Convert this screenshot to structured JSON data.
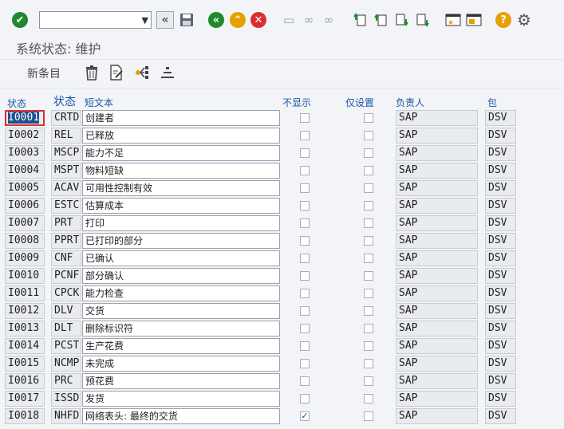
{
  "toolbar": {
    "command_field": {
      "value": "",
      "dropdown_icon": "chevron-down-icon"
    },
    "buttons": [
      {
        "name": "enter",
        "icon": "checkmark-icon",
        "color": "#1f8a2b"
      },
      {
        "name": "back-nav",
        "icon": "double-chevron-left-icon"
      },
      {
        "name": "save",
        "icon": "floppy-disk-icon"
      },
      {
        "name": "back",
        "icon": "back-icon",
        "color": "#1f8a2b"
      },
      {
        "name": "exit",
        "icon": "up-icon",
        "color": "#e5a100"
      },
      {
        "name": "cancel",
        "icon": "cancel-icon",
        "color": "#d9302f"
      }
    ]
  },
  "screen_title": "系统状态: 维护",
  "app_toolbar": {
    "new_entries_label": "新条目"
  },
  "columns": {
    "status1": "状态",
    "status2": "状态",
    "short_text": "短文本",
    "no_display": "不显示",
    "set_only": "仅设置",
    "responsible": "负责人",
    "package": "包"
  },
  "rows": [
    {
      "id": "I0001",
      "code": "CRTD",
      "text": "创建者",
      "no_display": false,
      "set_only": false,
      "responsible": "SAP",
      "package": "DSV"
    },
    {
      "id": "I0002",
      "code": "REL",
      "text": "已释放",
      "no_display": false,
      "set_only": false,
      "responsible": "SAP",
      "package": "DSV"
    },
    {
      "id": "I0003",
      "code": "MSCP",
      "text": "能力不足",
      "no_display": false,
      "set_only": false,
      "responsible": "SAP",
      "package": "DSV"
    },
    {
      "id": "I0004",
      "code": "MSPT",
      "text": "物料短缺",
      "no_display": false,
      "set_only": false,
      "responsible": "SAP",
      "package": "DSV"
    },
    {
      "id": "I0005",
      "code": "ACAV",
      "text": "可用性控制有效",
      "no_display": false,
      "set_only": false,
      "responsible": "SAP",
      "package": "DSV"
    },
    {
      "id": "I0006",
      "code": "ESTC",
      "text": "估算成本",
      "no_display": false,
      "set_only": false,
      "responsible": "SAP",
      "package": "DSV"
    },
    {
      "id": "I0007",
      "code": "PRT",
      "text": "打印",
      "no_display": false,
      "set_only": false,
      "responsible": "SAP",
      "package": "DSV"
    },
    {
      "id": "I0008",
      "code": "PPRT",
      "text": "已打印的部分",
      "no_display": false,
      "set_only": false,
      "responsible": "SAP",
      "package": "DSV"
    },
    {
      "id": "I0009",
      "code": "CNF",
      "text": "已确认",
      "no_display": false,
      "set_only": false,
      "responsible": "SAP",
      "package": "DSV"
    },
    {
      "id": "I0010",
      "code": "PCNF",
      "text": "部分确认",
      "no_display": false,
      "set_only": false,
      "responsible": "SAP",
      "package": "DSV"
    },
    {
      "id": "I0011",
      "code": "CPCK",
      "text": "能力检查",
      "no_display": false,
      "set_only": false,
      "responsible": "SAP",
      "package": "DSV"
    },
    {
      "id": "I0012",
      "code": "DLV",
      "text": "交货",
      "no_display": false,
      "set_only": false,
      "responsible": "SAP",
      "package": "DSV"
    },
    {
      "id": "I0013",
      "code": "DLT",
      "text": "删除标识符",
      "no_display": false,
      "set_only": false,
      "responsible": "SAP",
      "package": "DSV"
    },
    {
      "id": "I0014",
      "code": "PCST",
      "text": "生产花费",
      "no_display": false,
      "set_only": false,
      "responsible": "SAP",
      "package": "DSV"
    },
    {
      "id": "I0015",
      "code": "NCMP",
      "text": "未完成",
      "no_display": false,
      "set_only": false,
      "responsible": "SAP",
      "package": "DSV"
    },
    {
      "id": "I0016",
      "code": "PRC",
      "text": "预花费",
      "no_display": false,
      "set_only": false,
      "responsible": "SAP",
      "package": "DSV"
    },
    {
      "id": "I0017",
      "code": "ISSD",
      "text": "发货",
      "no_display": false,
      "set_only": false,
      "responsible": "SAP",
      "package": "DSV"
    },
    {
      "id": "I0018",
      "code": "NHFD",
      "text": "网络表头: 最终的交货",
      "no_display": true,
      "set_only": false,
      "responsible": "SAP",
      "package": "DSV"
    }
  ]
}
